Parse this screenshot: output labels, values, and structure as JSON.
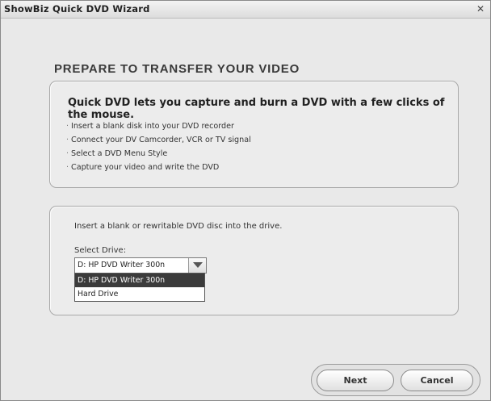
{
  "window": {
    "title": "ShowBiz Quick DVD Wizard",
    "close_label": "✕"
  },
  "heading": "PREPARE TO TRANSFER YOUR VIDEO",
  "intro_panel": {
    "intro": "Quick DVD lets you capture and burn a DVD with a few clicks of the mouse.",
    "bullet_char": "·",
    "bullets": [
      "Insert a blank disk into your DVD recorder",
      "Connect your DV Camcorder, VCR or TV signal",
      "Select a DVD Menu Style",
      "Capture your video and write the DVD"
    ]
  },
  "drive_panel": {
    "instruction": "Insert a blank or rewritable DVD disc into the drive.",
    "select_label": "Select Drive:",
    "selected_drive": "D: HP DVD Writer 300n",
    "options": [
      "D: HP DVD Writer 300n",
      "Hard Drive"
    ]
  },
  "buttons": {
    "next": "Next",
    "cancel": "Cancel"
  }
}
